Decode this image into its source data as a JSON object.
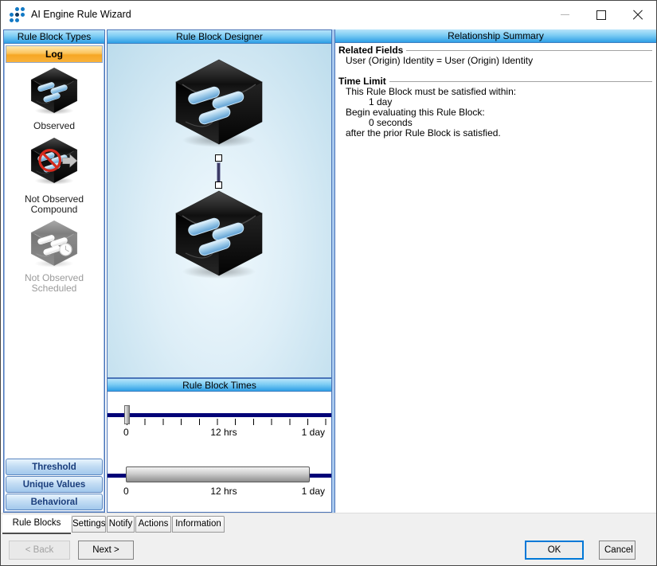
{
  "window": {
    "title": "AI Engine Rule Wizard"
  },
  "left_panel": {
    "header": "Rule Block Types",
    "log_button": "Log",
    "items": [
      {
        "label": "Observed"
      },
      {
        "label": "Not Observed Compound"
      },
      {
        "label": "Not Observed Scheduled"
      }
    ],
    "type_buttons": [
      {
        "label": "Threshold"
      },
      {
        "label": "Unique Values"
      },
      {
        "label": "Behavioral"
      }
    ]
  },
  "designer": {
    "header": "Rule Block Designer"
  },
  "times": {
    "header": "Rule Block Times",
    "satisfaction_slider": {
      "start": "0",
      "middle": "12 hrs",
      "end": "1 day"
    },
    "evaluation_slider": {
      "start": "0",
      "middle": "12 hrs",
      "end": "1 day"
    }
  },
  "summary": {
    "header": "Relationship Summary",
    "related_fields": {
      "title": "Related Fields",
      "line1": "User (Origin) Identity = User (Origin) Identity"
    },
    "time_limit": {
      "title": "Time Limit",
      "line1": "This Rule Block must be satisfied within:",
      "line2": "1 day",
      "line3": "Begin evaluating this Rule Block:",
      "line4": "0 seconds",
      "line5": "after the prior Rule Block is satisfied."
    }
  },
  "tabs": [
    {
      "label": "Rule Blocks"
    },
    {
      "label": "Settings"
    },
    {
      "label": "Notify"
    },
    {
      "label": "Actions"
    },
    {
      "label": "Information"
    }
  ],
  "footer": {
    "back": "< Back",
    "next": "Next >",
    "ok": "OK",
    "cancel": "Cancel"
  },
  "colors": {
    "header_gradient_top": "#b8e4fa",
    "header_gradient_bottom": "#2e9fe6",
    "log_button_orange": "#f6a625",
    "panel_border_blue": "#4a74b8",
    "slider_track_navy": "#020277",
    "ok_focus_border": "#0078d7"
  }
}
